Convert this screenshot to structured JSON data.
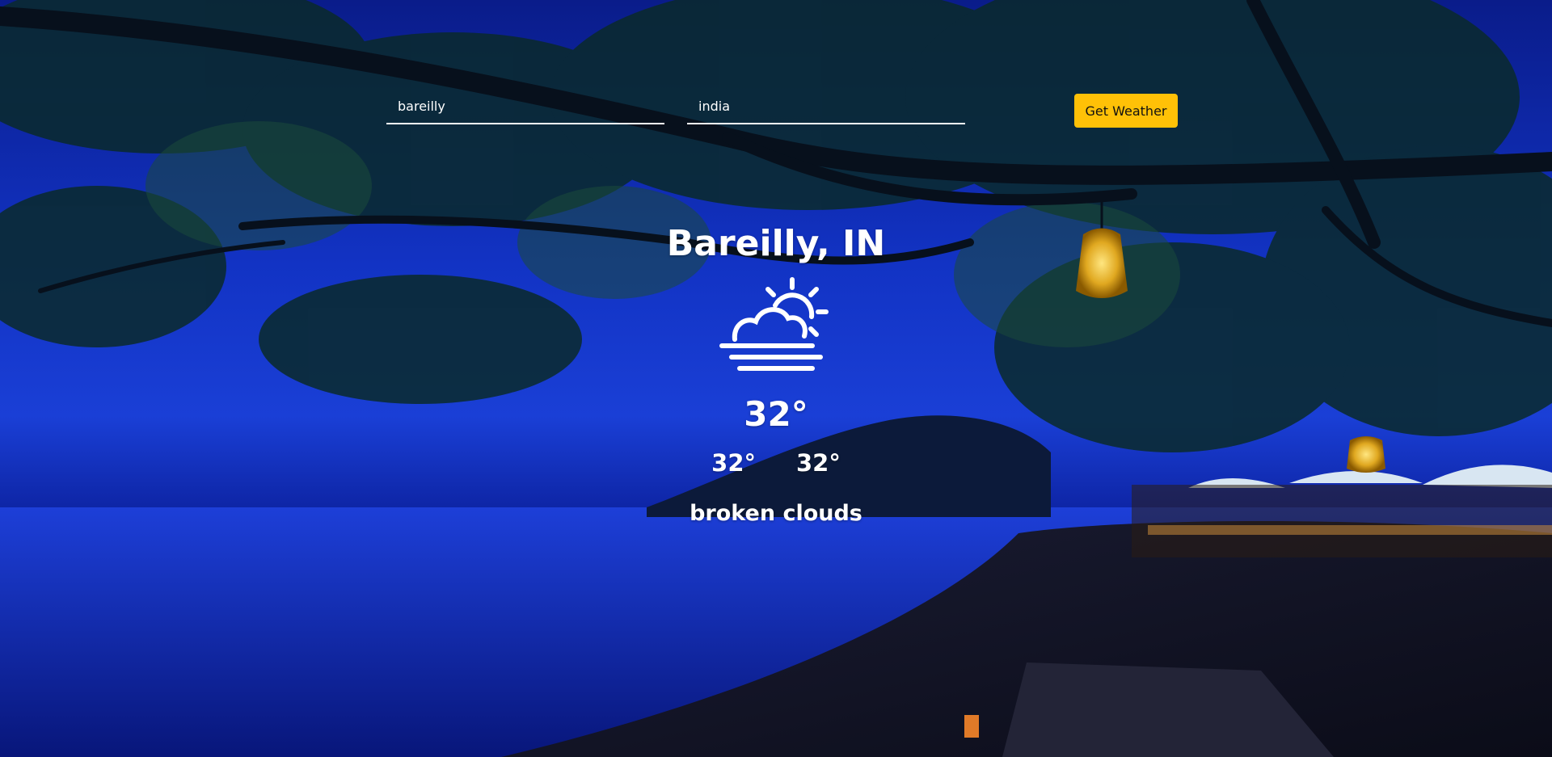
{
  "search": {
    "city_value": "bareilly",
    "country_value": "india",
    "button_label": "Get Weather"
  },
  "weather": {
    "location": "Bareilly, IN",
    "icon": "partly-cloudy-icon",
    "temperature": "32°",
    "min_temp": "32°",
    "max_temp": "32°",
    "description": "broken clouds"
  },
  "colors": {
    "accent": "#ffc107",
    "text": "#ffffff",
    "background": "#1233c4"
  }
}
